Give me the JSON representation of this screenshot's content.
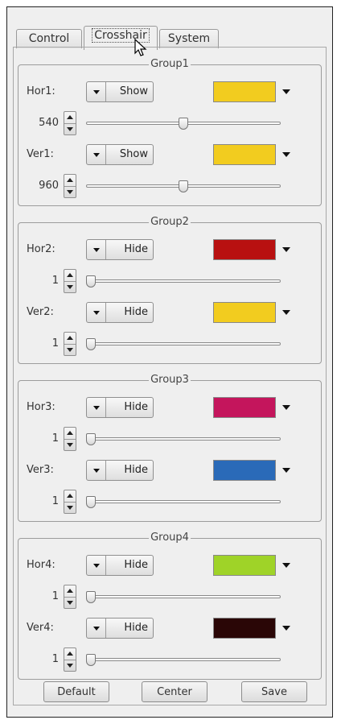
{
  "tabs": [
    {
      "label": "Control",
      "active": false
    },
    {
      "label": "Crosshair",
      "active": true
    },
    {
      "label": "System",
      "active": false
    }
  ],
  "groups": [
    {
      "title": "Group1",
      "lines": [
        {
          "label": "Hor1:",
          "mode": "Show",
          "color": "#f2cc1f",
          "value": "540",
          "slider_fraction": 0.5
        },
        {
          "label": "Ver1:",
          "mode": "Show",
          "color": "#f2cc1f",
          "value": "960",
          "slider_fraction": 0.5
        }
      ]
    },
    {
      "title": "Group2",
      "lines": [
        {
          "label": "Hor2:",
          "mode": "Hide",
          "color": "#b81010",
          "value": "1",
          "slider_fraction": 0.0
        },
        {
          "label": "Ver2:",
          "mode": "Hide",
          "color": "#f2cc1f",
          "value": "1",
          "slider_fraction": 0.0
        }
      ]
    },
    {
      "title": "Group3",
      "lines": [
        {
          "label": "Hor3:",
          "mode": "Hide",
          "color": "#c4155c",
          "value": "1",
          "slider_fraction": 0.0
        },
        {
          "label": "Ver3:",
          "mode": "Hide",
          "color": "#2a6ab8",
          "value": "1",
          "slider_fraction": 0.0
        }
      ]
    },
    {
      "title": "Group4",
      "lines": [
        {
          "label": "Hor4:",
          "mode": "Hide",
          "color": "#9fd328",
          "value": "1",
          "slider_fraction": 0.0
        },
        {
          "label": "Ver4:",
          "mode": "Hide",
          "color": "#2a0606",
          "value": "1",
          "slider_fraction": 0.0
        }
      ]
    }
  ],
  "buttons": {
    "default": "Default",
    "center": "Center",
    "save": "Save"
  }
}
